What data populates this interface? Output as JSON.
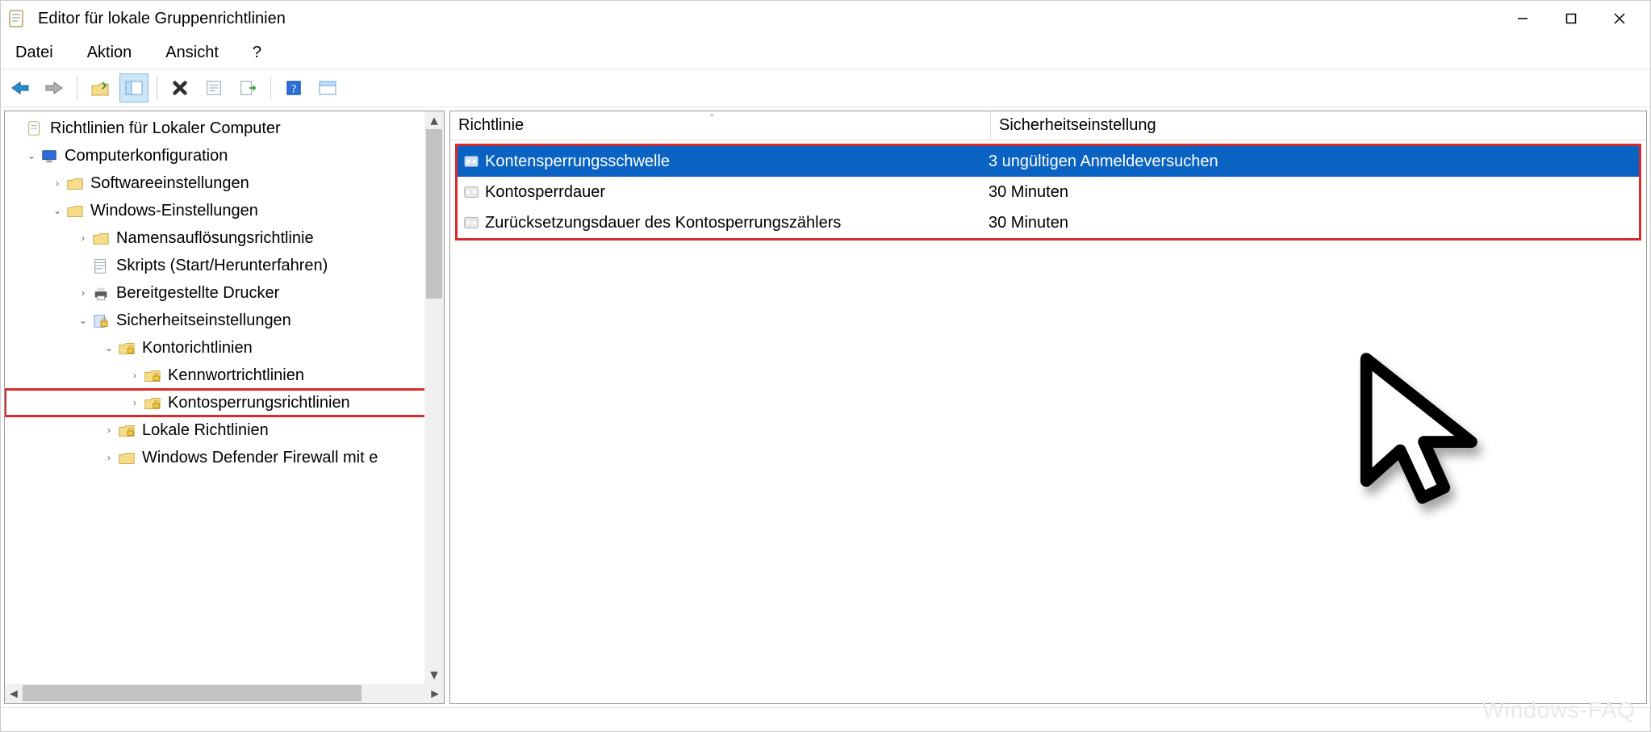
{
  "title": "Editor für lokale Gruppenrichtlinien",
  "menu": {
    "file": "Datei",
    "action": "Aktion",
    "view": "Ansicht",
    "help": "?"
  },
  "tree": {
    "root": "Richtlinien für Lokaler Computer",
    "n0": "Computerkonfiguration",
    "n0_0": "Softwareeinstellungen",
    "n0_1": "Windows-Einstellungen",
    "n0_1_0": "Namensauflösungsrichtlinie",
    "n0_1_1": "Skripts (Start/Herunterfahren)",
    "n0_1_2": "Bereitgestellte Drucker",
    "n0_1_3": "Sicherheitseinstellungen",
    "n0_1_3_0": "Kontorichtlinien",
    "n0_1_3_0_0": "Kennwortrichtlinien",
    "n0_1_3_0_1": "Kontosperrungsrichtlinien",
    "n0_1_3_1": "Lokale Richtlinien",
    "n0_1_3_2": "Windows Defender Firewall mit e"
  },
  "columns": {
    "policy": "Richtlinie",
    "setting": "Sicherheitseinstellung"
  },
  "rows": [
    {
      "policy": "Kontensperrungsschwelle",
      "setting": "3 ungültigen Anmeldeversuchen",
      "selected": true
    },
    {
      "policy": "Kontosperrdauer",
      "setting": "30 Minuten",
      "selected": false
    },
    {
      "policy": "Zurücksetzungsdauer des Kontosperrungszählers",
      "setting": "30 Minuten",
      "selected": false
    }
  ],
  "watermark": "Windows-FAQ"
}
